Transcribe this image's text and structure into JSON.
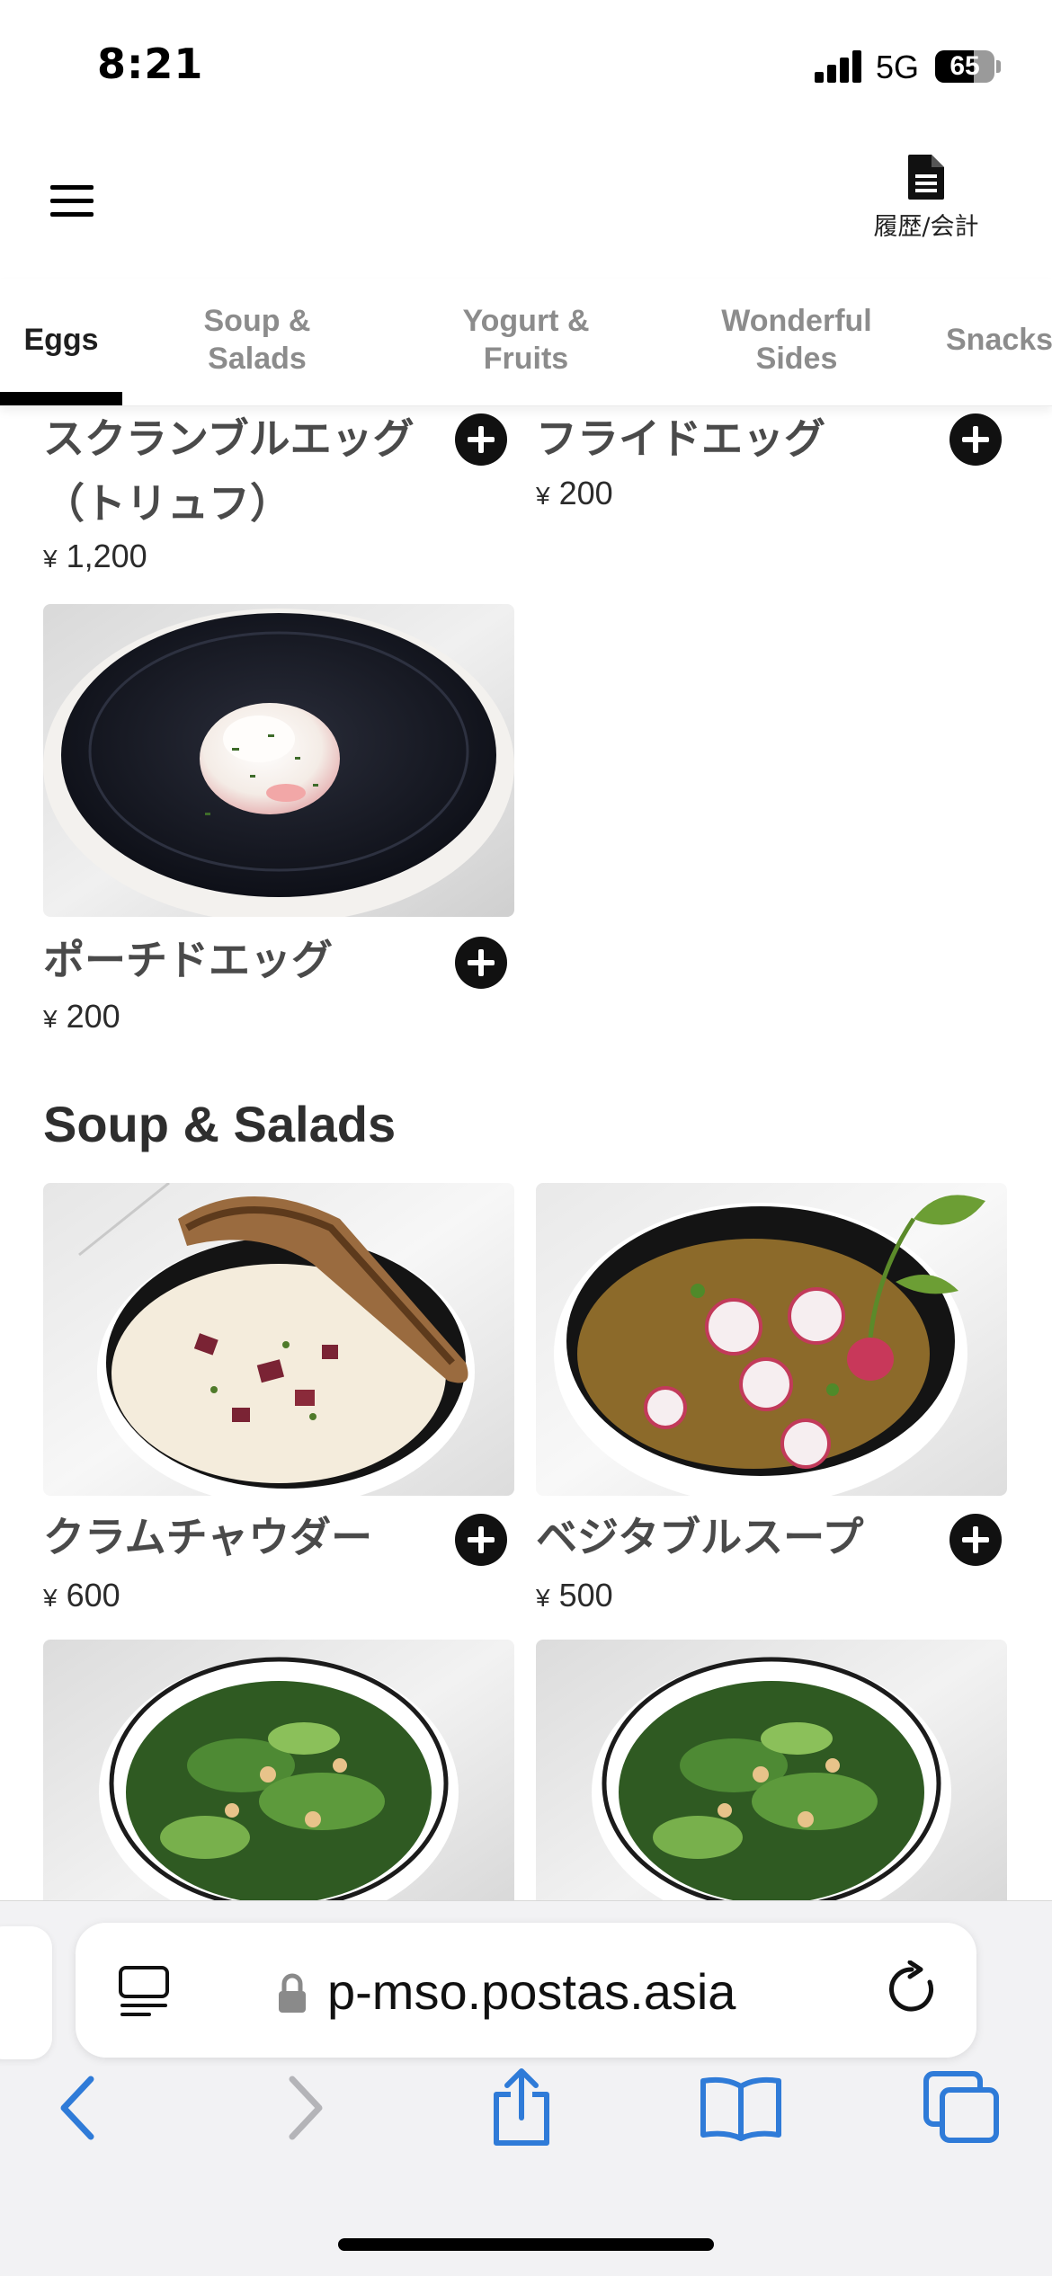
{
  "status_bar": {
    "time": "8:21",
    "network": "5G",
    "battery_percent": "65",
    "battery_level": 0.65
  },
  "header": {
    "menu_icon": "hamburger-menu-icon",
    "history_icon": "document-icon",
    "history_label": "履歴/会計"
  },
  "tabs": [
    {
      "label": "Eggs",
      "active": true
    },
    {
      "label": "Soup &\nSalads",
      "active": false
    },
    {
      "label": "Yogurt &\nFruits",
      "active": false
    },
    {
      "label": "Wonderful\nSides",
      "active": false
    },
    {
      "label": "Snacks",
      "active": false
    }
  ],
  "eggs": {
    "items": [
      {
        "name": "スクランブルエッグ\n（トリュフ）",
        "currency": "¥",
        "price": "1,200"
      },
      {
        "name": "フライドエッグ",
        "currency": "¥",
        "price": "200"
      },
      {
        "name": "ポーチドエッグ",
        "currency": "¥",
        "price": "200"
      }
    ]
  },
  "soup_salads": {
    "title": "Soup & Salads",
    "items": [
      {
        "name": "クラムチャウダー",
        "currency": "¥",
        "price": "600"
      },
      {
        "name": "ベジタブルスープ",
        "currency": "¥",
        "price": "500"
      }
    ]
  },
  "browser": {
    "url": "p-mso.postas.asia",
    "icons": [
      "reader-icon",
      "lock-icon",
      "reload-icon",
      "back-icon",
      "forward-icon",
      "share-icon",
      "bookmarks-icon",
      "tabs-icon"
    ]
  },
  "colors": {
    "accent": "#000000",
    "safari_blue": "#2f7bd8",
    "tab_inactive": "#8c8c8c"
  }
}
